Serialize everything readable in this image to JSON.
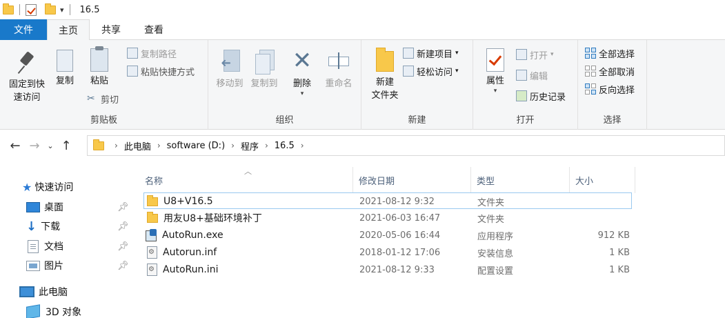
{
  "title_bar": {
    "title": "16.5"
  },
  "tabs": [
    {
      "label": "文件"
    },
    {
      "label": "主页"
    },
    {
      "label": "共享"
    },
    {
      "label": "查看"
    }
  ],
  "ribbon": {
    "clipboard": {
      "label": "剪贴板",
      "pin_line1": "固定到快",
      "pin_line2": "速访问",
      "copy": "复制",
      "paste": "粘贴",
      "copy_path": "复制路径",
      "paste_shortcut": "粘贴快捷方式",
      "cut": "剪切"
    },
    "organize": {
      "label": "组织",
      "move_to": "移动到",
      "copy_to": "复制到",
      "delete": "删除",
      "rename": "重命名"
    },
    "new": {
      "label": "新建",
      "new_folder_line1": "新建",
      "new_folder_line2": "文件夹",
      "new_item": "新建项目",
      "easy_access": "轻松访问"
    },
    "open": {
      "label": "打开",
      "properties": "属性",
      "open": "打开",
      "edit": "编辑",
      "history": "历史记录"
    },
    "select": {
      "label": "选择",
      "select_all": "全部选择",
      "select_none": "全部取消",
      "invert": "反向选择"
    }
  },
  "address": {
    "crumbs": [
      "此电脑",
      "software (D:)",
      "程序",
      "16.5"
    ]
  },
  "sidebar": {
    "quick_access": "快速访问",
    "items": [
      {
        "label": "桌面"
      },
      {
        "label": "下载"
      },
      {
        "label": "文档"
      },
      {
        "label": "图片"
      }
    ],
    "this_pc": "此电脑",
    "objects_3d": "3D 对象"
  },
  "columns": {
    "name": "名称",
    "date": "修改日期",
    "type": "类型",
    "size": "大小"
  },
  "files": [
    {
      "name": "U8+V16.5",
      "date": "2021-08-12 9:32",
      "type": "文件夹",
      "size": "",
      "icon": "folder-icon"
    },
    {
      "name": "用友U8+基础环境补丁",
      "date": "2021-06-03 16:47",
      "type": "文件夹",
      "size": "",
      "icon": "folder-icon"
    },
    {
      "name": "AutoRun.exe",
      "date": "2020-05-06 16:44",
      "type": "应用程序",
      "size": "912 KB",
      "icon": "exe-icon"
    },
    {
      "name": "Autorun.inf",
      "date": "2018-01-12 17:06",
      "type": "安装信息",
      "size": "1 KB",
      "icon": "config-file-icon"
    },
    {
      "name": "AutoRun.ini",
      "date": "2021-08-12 9:33",
      "type": "配置设置",
      "size": "1 KB",
      "icon": "config-file-icon"
    }
  ]
}
